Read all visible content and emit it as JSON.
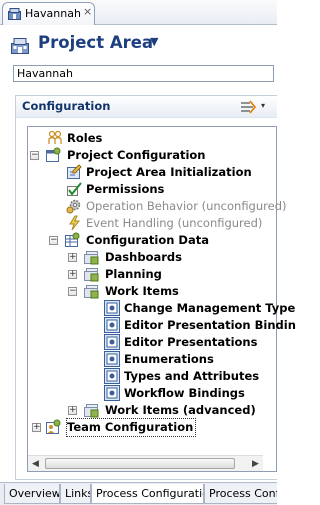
{
  "editor_tab": {
    "title": "Havannah",
    "close_glyph": "×",
    "icon": "project-area-icon"
  },
  "header": {
    "title": "Project Area",
    "menu_caret": "▼",
    "name_value": "Havannah"
  },
  "section": {
    "title": "Configuration",
    "toolbar_icon": "collapse-all-icon",
    "menu_caret": "▾"
  },
  "tree": {
    "roles": "Roles",
    "project_configuration": "Project Configuration",
    "project_area_initialization": "Project Area Initialization",
    "permissions": "Permissions",
    "operation_behavior": "Operation Behavior (unconfigured)",
    "event_handling": "Event Handling (unconfigured)",
    "configuration_data": "Configuration Data",
    "dashboards": "Dashboards",
    "planning": "Planning",
    "work_items": "Work Items",
    "change_management_types": "Change Management Type",
    "editor_presentation_bindings": "Editor Presentation Bindin",
    "editor_presentations": "Editor Presentations",
    "enumerations": "Enumerations",
    "types_and_attributes": "Types and Attributes",
    "workflow_bindings": "Workflow Bindings",
    "work_items_advanced": "Work Items (advanced)",
    "team_configuration": "Team Configuration",
    "expand_glyph": "+",
    "collapse_glyph": "−"
  },
  "scrollbar": {
    "left_arrow": "◀",
    "right_arrow": "▶"
  },
  "bottom_tabs": [
    {
      "label": "Overview",
      "selected": false
    },
    {
      "label": "Links",
      "selected": false
    },
    {
      "label": "Process Configuration",
      "selected": true
    },
    {
      "label": "Process Configu",
      "selected": false
    }
  ]
}
